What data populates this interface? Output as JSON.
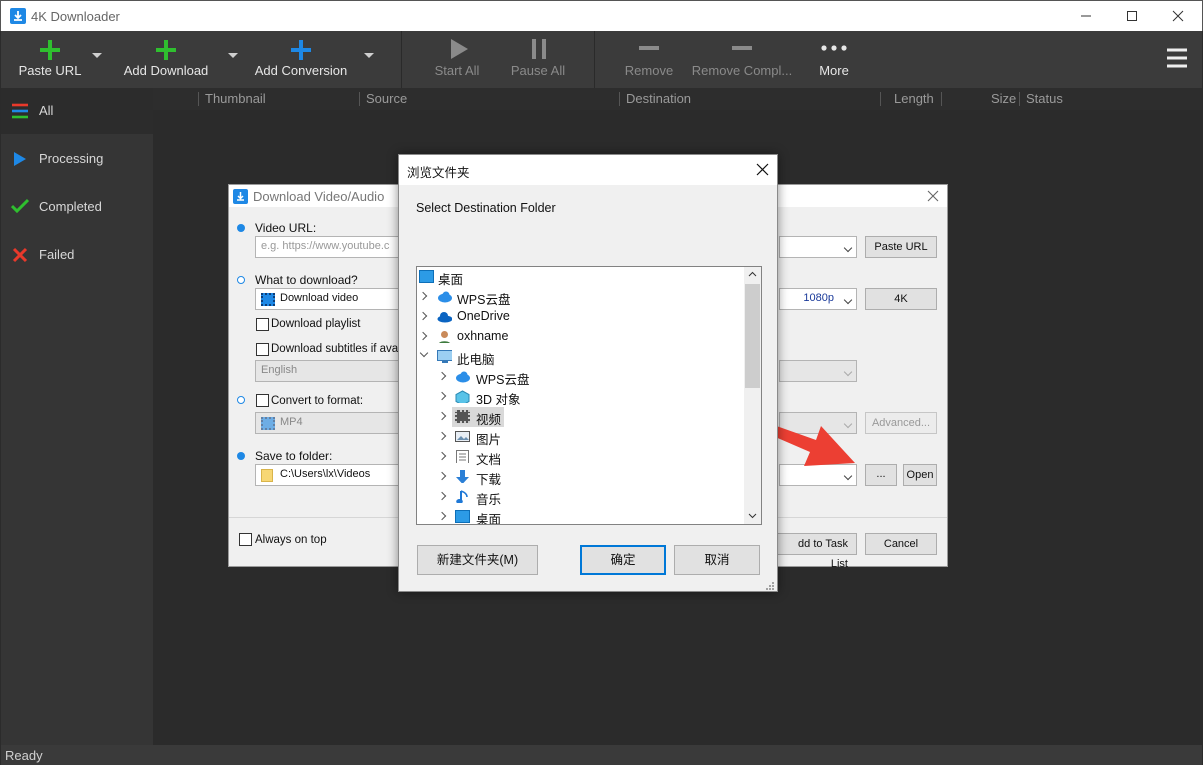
{
  "app": {
    "title": "4K Downloader",
    "status": "Ready"
  },
  "toolbar": {
    "paste_url": "Paste URL",
    "add_download": "Add Download",
    "add_conversion": "Add Conversion",
    "start_all": "Start All",
    "pause_all": "Pause All",
    "remove": "Remove",
    "remove_completed": "Remove Compl...",
    "more": "More"
  },
  "sidebar": {
    "items": [
      {
        "label": "All",
        "icon": "menu-lines-icon"
      },
      {
        "label": "Processing",
        "icon": "play-icon"
      },
      {
        "label": "Completed",
        "icon": "checkmark-icon"
      },
      {
        "label": "Failed",
        "icon": "x-icon"
      }
    ]
  },
  "columns": [
    "Thumbnail",
    "Source",
    "Destination",
    "Length",
    "Size",
    "Status"
  ],
  "download_dialog": {
    "title": "Download Video/Audio",
    "video_url_label": "Video URL:",
    "video_url_placeholder": "e.g. https://www.youtube.c",
    "paste_url_button": "Paste URL",
    "what_label": "What to download?",
    "what_value": "Download video",
    "quality": "1080p",
    "quality_button": "4K",
    "playlist_label": "Download playlist",
    "subtitles_label": "Download subtitles if availa",
    "subtitle_lang": "English",
    "convert_label": "Convert to format:",
    "format_value": "MP4",
    "advanced_button": "Advanced...",
    "save_label": "Save to folder:",
    "save_value": "C:\\Users\\lx\\Videos",
    "browse_button": "...",
    "open_button": "Open",
    "always_on_top": "Always on top",
    "add_task": "dd to Task List",
    "cancel": "Cancel"
  },
  "browse_dialog": {
    "title": "浏览文件夹",
    "instruction": "Select Destination Folder",
    "tree": [
      {
        "label": "桌面",
        "icon": "desktop-icon",
        "level": 0
      },
      {
        "label": "WPS云盘",
        "icon": "cloud-icon",
        "level": 1
      },
      {
        "label": "OneDrive",
        "icon": "onedrive-icon",
        "level": 1
      },
      {
        "label": "oxhname",
        "icon": "user-icon",
        "level": 1
      },
      {
        "label": "此电脑",
        "icon": "computer-icon",
        "level": 1,
        "expanded": true
      },
      {
        "label": "WPS云盘",
        "icon": "cloud-icon",
        "level": 2
      },
      {
        "label": "3D 对象",
        "icon": "cube-icon",
        "level": 2
      },
      {
        "label": "视频",
        "icon": "film-icon",
        "level": 2,
        "selected": true
      },
      {
        "label": "图片",
        "icon": "picture-icon",
        "level": 2
      },
      {
        "label": "文档",
        "icon": "document-icon",
        "level": 2
      },
      {
        "label": "下载",
        "icon": "download-arrow-icon",
        "level": 2
      },
      {
        "label": "音乐",
        "icon": "music-note-icon",
        "level": 2
      },
      {
        "label": "桌面",
        "icon": "desktop-icon",
        "level": 2
      }
    ],
    "new_folder": "新建文件夹(M)",
    "ok": "确定",
    "cancel": "取消"
  },
  "colors": {
    "accent": "#1e88e5",
    "green": "#2fbf2f",
    "red": "#e8392b",
    "arrow": "#ec3f33"
  }
}
